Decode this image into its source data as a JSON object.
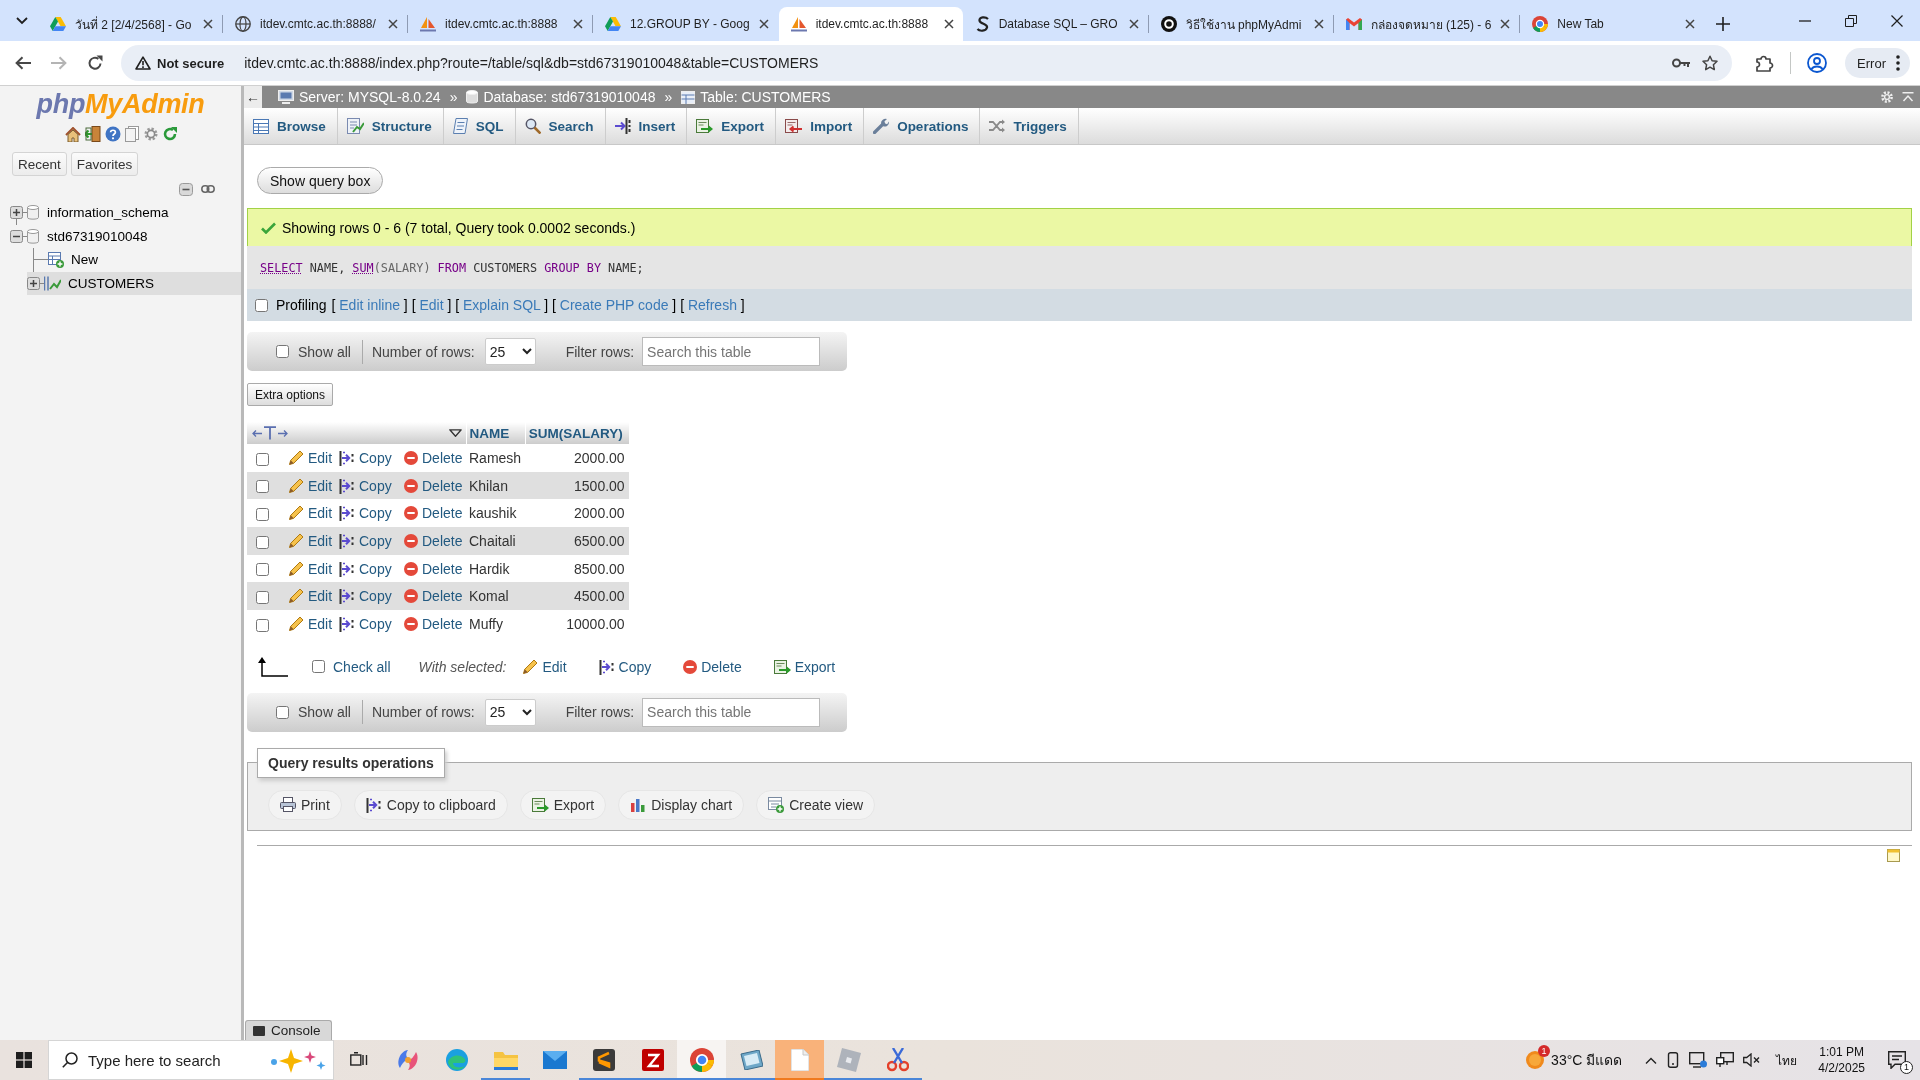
{
  "browser": {
    "tabs": [
      {
        "title": "วันที่ 2 [2/4/2568] - Go",
        "selected": false
      },
      {
        "title": "itdev.cmtc.ac.th:8888/",
        "selected": false
      },
      {
        "title": "itdev.cmtc.ac.th:8888",
        "selected": false
      },
      {
        "title": "12.GROUP BY - Goog",
        "selected": false
      },
      {
        "title": "itdev.cmtc.ac.th:8888",
        "selected": true
      },
      {
        "title": "Database SQL – GRO",
        "selected": false
      },
      {
        "title": "วิธีใช้งาน phpMyAdmi",
        "selected": false
      },
      {
        "title": "กล่องจดหมาย (125) - 6",
        "selected": false
      },
      {
        "title": "New Tab",
        "selected": false
      }
    ],
    "address_bar": {
      "security_label": "Not secure",
      "url": "itdev.cmtc.ac.th:8888/index.php?route=/table/sql&db=std67319010048&table=CUSTOMERS"
    },
    "profile_button": "Error"
  },
  "sidebar": {
    "logo": [
      "php",
      "MyAdmin"
    ],
    "buttons": [
      "Recent",
      "Favorites"
    ],
    "tree": [
      {
        "kind": "database",
        "label": "information_schema",
        "expanded": false,
        "selected": false
      },
      {
        "kind": "database",
        "label": "std67319010048",
        "expanded": true,
        "selected": false,
        "children": [
          {
            "kind": "new",
            "label": "New",
            "selected": false
          },
          {
            "kind": "table",
            "label": "CUSTOMERS",
            "expanded": false,
            "selected": true
          }
        ]
      }
    ]
  },
  "breadcrumb": {
    "collapse": "←",
    "items": [
      "Server: MYSQL-8.0.24",
      "Database: std67319010048",
      "Table: CUSTOMERS"
    ],
    "separators": [
      "»",
      "»"
    ]
  },
  "menu_tabs": [
    {
      "label": "Browse",
      "selected": false
    },
    {
      "label": "Structure",
      "selected": false
    },
    {
      "label": "SQL",
      "selected": false
    },
    {
      "label": "Search",
      "selected": false
    },
    {
      "label": "Insert",
      "selected": false
    },
    {
      "label": "Export",
      "selected": false
    },
    {
      "label": "Import",
      "selected": false
    },
    {
      "label": "Operations",
      "selected": false
    },
    {
      "label": "Triggers",
      "selected": false
    }
  ],
  "show_query_button": "Show query box",
  "message": "Showing rows 0 - 6 (7 total, Query took 0.0002 seconds.)",
  "sql": [
    {
      "kind": "linked_keyword",
      "text": "SELECT"
    },
    {
      "kind": "plain",
      "text": "NAME,"
    },
    {
      "kind": "linked_keyword",
      "text": "SUM"
    },
    {
      "kind": "paren",
      "text": "(SALARY)"
    },
    {
      "kind": "keyword",
      "text": "FROM"
    },
    {
      "kind": "plain",
      "text": "CUSTOMERS"
    },
    {
      "kind": "keyword",
      "text": "GROUP BY"
    },
    {
      "kind": "plain",
      "text": "NAME;"
    }
  ],
  "profiling": {
    "label": "Profiling",
    "checked": false,
    "links": [
      {
        "before": "[",
        "label": "Edit inline",
        "after": "]"
      },
      {
        "before": "[",
        "label": "Edit",
        "after": "]"
      },
      {
        "before": "[",
        "label": "Explain SQL",
        "after": "]"
      },
      {
        "before": "[",
        "label": "Create PHP code",
        "after": "]"
      },
      {
        "before": "[",
        "label": "Refresh",
        "after": "]"
      }
    ]
  },
  "navigation_top": {
    "show_all": {
      "label": "Show all",
      "checked": false
    },
    "rows_label": "Number of rows:",
    "rows_value": "25",
    "filter": {
      "label": "Filter rows:",
      "placeholder": "Search this table"
    }
  },
  "extra_options_button": "Extra options",
  "table": {
    "columns": [
      "NAME",
      "SUM(SALARY)"
    ],
    "rows": [
      {
        "checked": false,
        "actions": [
          "Edit",
          "Copy",
          "Delete"
        ],
        "cells": [
          "Ramesh",
          "2000.00"
        ]
      },
      {
        "checked": false,
        "actions": [
          "Edit",
          "Copy",
          "Delete"
        ],
        "cells": [
          "Khilan",
          "1500.00"
        ]
      },
      {
        "checked": false,
        "actions": [
          "Edit",
          "Copy",
          "Delete"
        ],
        "cells": [
          "kaushik",
          "2000.00"
        ]
      },
      {
        "checked": false,
        "actions": [
          "Edit",
          "Copy",
          "Delete"
        ],
        "cells": [
          "Chaitali",
          "6500.00"
        ]
      },
      {
        "checked": false,
        "actions": [
          "Edit",
          "Copy",
          "Delete"
        ],
        "cells": [
          "Hardik",
          "8500.00"
        ]
      },
      {
        "checked": false,
        "actions": [
          "Edit",
          "Copy",
          "Delete"
        ],
        "cells": [
          "Komal",
          "4500.00"
        ]
      },
      {
        "checked": false,
        "actions": [
          "Edit",
          "Copy",
          "Delete"
        ],
        "cells": [
          "Muffy",
          "10000.00"
        ]
      }
    ]
  },
  "bulk_actions": {
    "check_all": {
      "label": "Check all",
      "checked": false
    },
    "with_selected": "With selected:",
    "buttons": [
      "Edit",
      "Copy",
      "Delete",
      "Export"
    ]
  },
  "navigation_bottom": {
    "show_all": {
      "label": "Show all",
      "checked": false
    },
    "rows_label": "Number of rows:",
    "rows_value": "25",
    "filter": {
      "label": "Filter rows:",
      "placeholder": "Search this table"
    }
  },
  "query_results_operations": {
    "legend": "Query results operations",
    "buttons": [
      "Print",
      "Copy to clipboard",
      "Export",
      "Display chart",
      "Create view"
    ]
  },
  "console_tab": "Console",
  "taskbar": {
    "search": {
      "placeholder": "Type here to search"
    },
    "apps": [
      {
        "running": false,
        "selected": false,
        "flashing": false
      },
      {
        "running": false,
        "selected": false,
        "flashing": false
      },
      {
        "running": true,
        "selected": false,
        "flashing": false
      },
      {
        "running": false,
        "selected": false,
        "flashing": false
      },
      {
        "running": true,
        "selected": false,
        "flashing": false
      },
      {
        "running": true,
        "selected": false,
        "flashing": false
      },
      {
        "running": true,
        "selected": true,
        "flashing": false
      },
      {
        "running": true,
        "selected": false,
        "flashing": false
      },
      {
        "running": true,
        "selected": false,
        "flashing": true
      },
      {
        "running": true,
        "selected": false,
        "flashing": false
      },
      {
        "running": true,
        "selected": false,
        "flashing": false
      }
    ],
    "weather": {
      "badge": "1",
      "text": "33°C มีแดด"
    },
    "language": "ไทย",
    "time": "1:01 PM",
    "date": "4/2/2025",
    "notification_badge": "1"
  }
}
